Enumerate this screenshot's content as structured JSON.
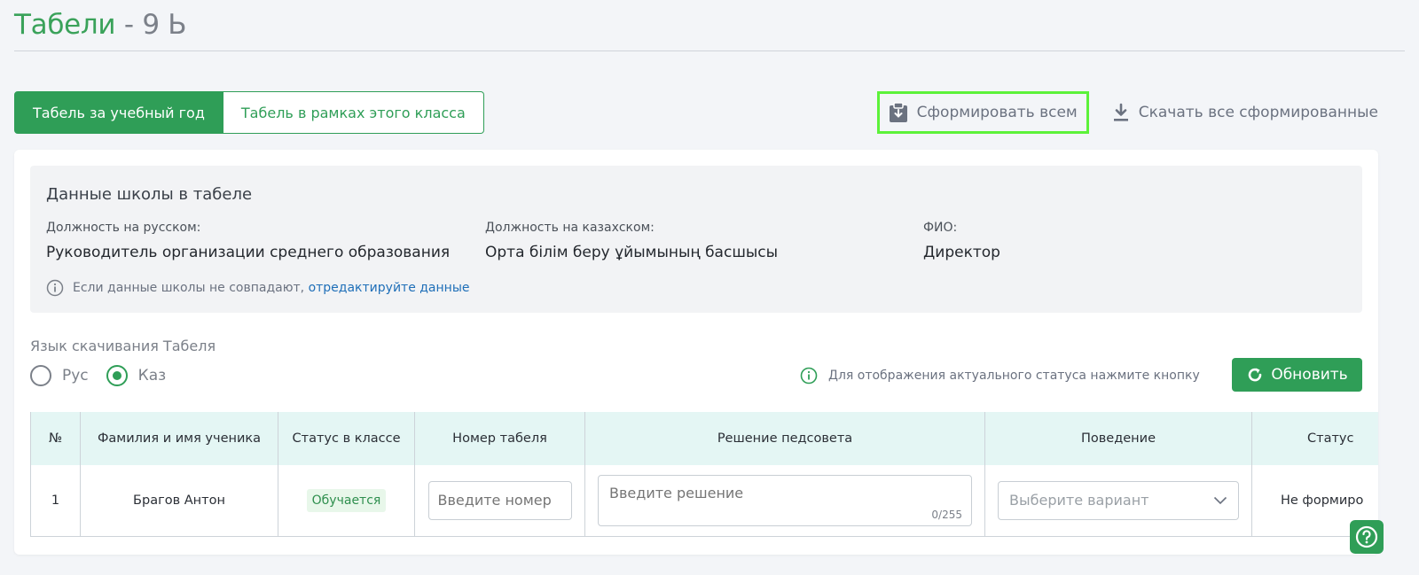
{
  "header": {
    "title": "Табели",
    "separator": "-",
    "class_name": "9 Ь"
  },
  "tabs": [
    {
      "label": "Табель за учебный год",
      "active": true
    },
    {
      "label": "Табель в рамках этого класса",
      "active": false
    }
  ],
  "actions": {
    "generate_all": "Сформировать всем",
    "download_all": "Скачать все сформированные"
  },
  "school_data": {
    "title": "Данные школы в табеле",
    "fields": [
      {
        "label": "Должность на русском:",
        "value": "Руководитель организации среднего образования"
      },
      {
        "label": "Должность на казахском:",
        "value": "Орта білім беру ұйымының басшысы"
      },
      {
        "label": "ФИО:",
        "value": "Директор"
      }
    ],
    "note_text": "Если данные школы не совпадают,",
    "note_link": "отредактируйте данные"
  },
  "language": {
    "label": "Язык скачивания Табеля",
    "options": [
      {
        "label": "Рус",
        "selected": false
      },
      {
        "label": "Каз",
        "selected": true
      }
    ]
  },
  "status_hint": "Для отображения актуального статуса нажмите кнопку",
  "refresh_label": "Обновить",
  "table": {
    "columns": [
      "№",
      "Фамилия и имя ученика",
      "Статус в классе",
      "Номер табеля",
      "Решение педсовета",
      "Поведение",
      "Статус"
    ],
    "rows": [
      {
        "num": "1",
        "name": "Брагов Антон",
        "class_status": "Обучается",
        "number_placeholder": "Введите номер",
        "decision_placeholder": "Введите решение",
        "decision_counter": "0/255",
        "behavior_placeholder": "Выберите вариант",
        "status": "Не формиро"
      }
    ]
  },
  "colors": {
    "accent": "#2f9e57",
    "title_green": "#3aa25a",
    "link": "#1f6fb8",
    "header_bg": "#e4f6f4",
    "highlight": "#5cf23a"
  }
}
